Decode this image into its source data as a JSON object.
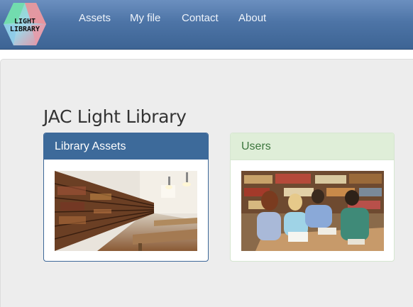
{
  "logo": {
    "line1": "LIGHT",
    "line2": "LIBRARY"
  },
  "nav": {
    "items": [
      "Assets",
      "My file",
      "Contact",
      "About"
    ]
  },
  "main": {
    "title": "JAC Light Library",
    "panels": [
      {
        "heading": "Library Assets",
        "image": "library-bookshelves-photo"
      },
      {
        "heading": "Users",
        "image": "students-studying-photo"
      }
    ]
  },
  "colors": {
    "navbar": "#4d74a6",
    "panel_primary": "#3d6a9a",
    "panel_success_bg": "#dfeed8",
    "panel_success_text": "#3c763d"
  }
}
